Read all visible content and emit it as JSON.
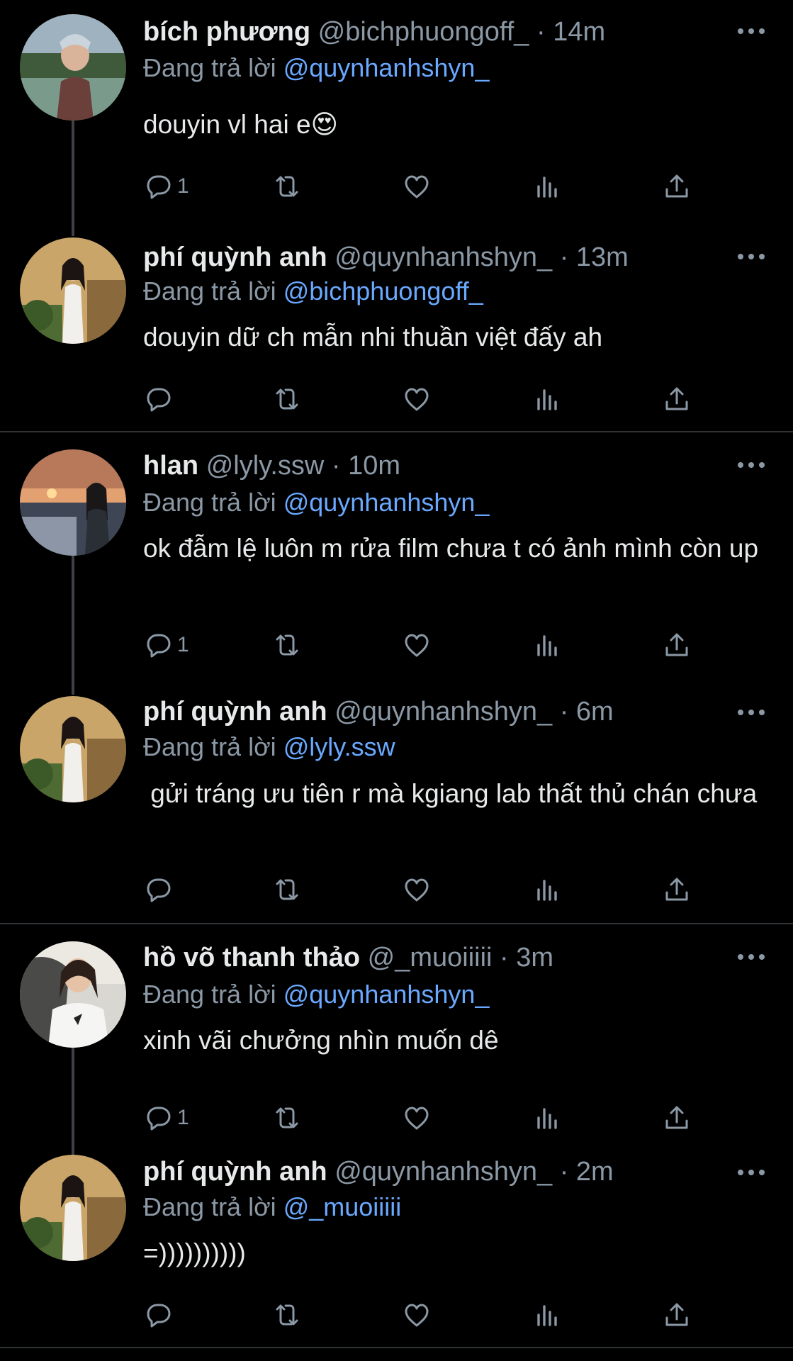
{
  "labels": {
    "replying_to": "Đang trả lời"
  },
  "tweets": [
    {
      "name": "bích phương",
      "handle": "@bichphuongoff_",
      "time": "14m",
      "reply_to": "@quynhanhshyn_",
      "text": "douyin vl hai e😍",
      "reply_count": "1"
    },
    {
      "name": "phí quỳnh anh",
      "handle": "@quynhanhshyn_",
      "time": "13m",
      "reply_to": "@bichphuongoff_",
      "text": "douyin dữ ch mẫn nhi thuần việt đấy ah",
      "reply_count": ""
    },
    {
      "name": "hlan",
      "handle": "@lyly.ssw",
      "time": "10m",
      "reply_to": "@quynhanhshyn_",
      "text": "ok đẫm lệ luôn m rửa film chưa t có ảnh mình còn up",
      "reply_count": "1"
    },
    {
      "name": "phí quỳnh anh",
      "handle": "@quynhanhshyn_",
      "time": "6m",
      "reply_to": "@lyly.ssw",
      "text": " gửi tráng ưu tiên r mà kgiang lab thất thủ chán chưa",
      "reply_count": ""
    },
    {
      "name": "hồ võ thanh thảo",
      "handle": "@_muoiiiii",
      "time": "3m",
      "reply_to": "@quynhanhshyn_",
      "text": "xinh vãi chưởng nhìn muốn dê",
      "reply_count": "1"
    },
    {
      "name": "phí quỳnh anh",
      "handle": "@quynhanhshyn_",
      "time": "2m",
      "reply_to": "@_muoiiiii",
      "text": "=))))))))))",
      "reply_count": ""
    }
  ],
  "icons": {
    "reply": "reply-icon",
    "retweet": "retweet-icon",
    "like": "heart-icon",
    "views": "views-chart-icon",
    "share": "share-icon",
    "more": "more-dots-icon"
  },
  "colors": {
    "background": "#000000",
    "text": "#e7e9ea",
    "muted": "#8b98a5",
    "mention": "#6aa9ff",
    "divider": "#2f3336"
  }
}
